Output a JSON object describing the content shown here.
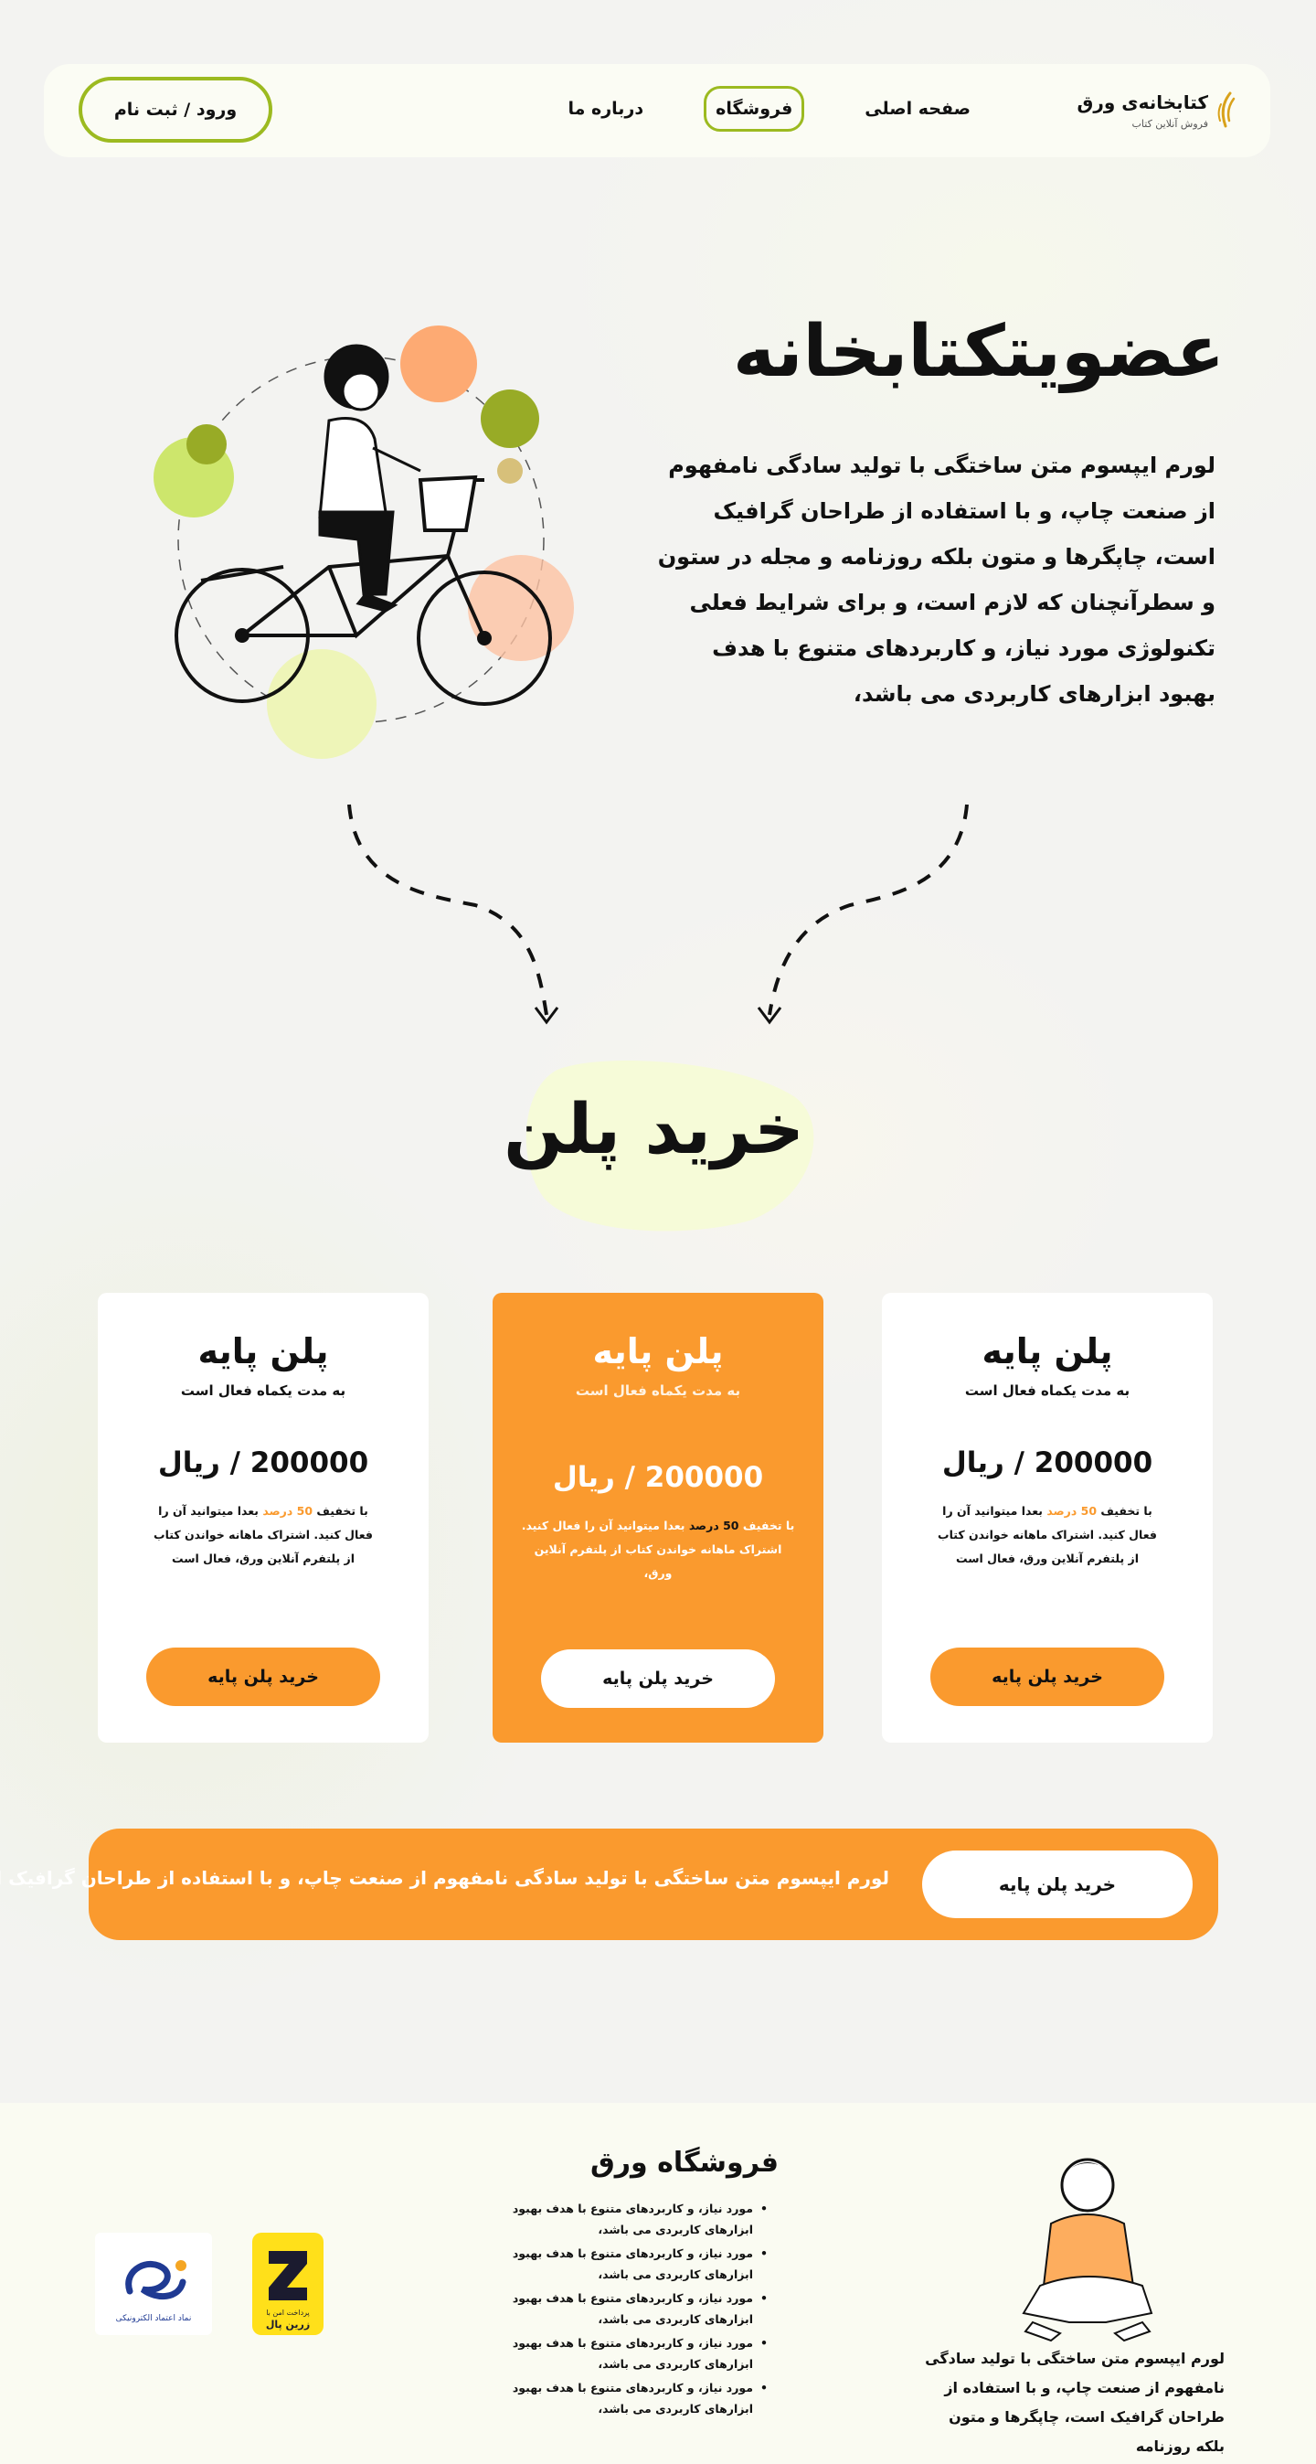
{
  "header": {
    "logo_name": "کتابخانه‌ی ورق",
    "logo_tagline": "فروش آنلاین کتاب",
    "nav": [
      {
        "label": "صفحه اصلی"
      },
      {
        "label": "فروشگاه"
      },
      {
        "label": "درباره ما"
      }
    ],
    "active_nav": "فروشگاه",
    "login_label": "ورود / ثبت نام",
    "accent_color": "#9cba20"
  },
  "hero": {
    "title": "عضویتکتابخانه",
    "text": "لورم ایپسوم متن ساختگی با تولید سادگی نامفهوم از صنعت چاپ، و با استفاده از طراحان گرافیک است، چاپگرها و متون بلکه روزنامه و مجله در ستون و سطرآنچنان که لازم است، و برای شرایط فعلی تکنولوژی مورد نیاز، و کاربردهای متنوع با هدف بهبود ابزارهای کاربردی می باشد،"
  },
  "plans": {
    "title": "خرید پلن",
    "cards": [
      {
        "title": "پلن پایه",
        "subtitle": "به مدت یکماه فعال است",
        "price": "200000 / ریال",
        "desc_prefix": "با تخفیف",
        "desc_highlight": "50 درصد",
        "desc_suffix": "بعدا میتوانید آن را فعال کنید. اشتراک ماهانه خواندن کتاب از پلتفرم آنلاین ورق، فعال است",
        "button": "خرید پلن پایه"
      },
      {
        "title": "پلن پایه",
        "subtitle": "به مدت یکماه فعال است",
        "price": "200000 / ریال",
        "desc_prefix": "با تخفیف",
        "desc_highlight": "50 درصد",
        "desc_suffix": "بعدا میتوانید آن را فعال کنید. اشتراک ماهانه خواندن کتاب از پلتفرم آنلاین ورق،",
        "button": "خرید پلن پایه"
      },
      {
        "title": "پلن پایه",
        "subtitle": "به مدت یکماه فعال است",
        "price": "200000 / ریال",
        "desc_prefix": "با تخفیف",
        "desc_highlight": "50 درصد",
        "desc_suffix": "بعدا میتوانید آن را فعال کنید. اشتراک ماهانه خواندن کتاب از پلتفرم آنلاین ورق، فعال است",
        "button": "خرید پلن پایه"
      }
    ],
    "accent_color": "#fa9a2e"
  },
  "banner": {
    "text": "لورم ایپسوم متن ساختگی با تولید سادگی نامفهوم از صنعت چاپ، و با استفاده از طراحان گرافیک است.",
    "button": "خرید پلن پایه"
  },
  "footer": {
    "about": "لورم ایپسوم متن ساختگی با تولید سادگی نامفهوم از صنعت چاپ، و با استفاده از طراحان گرافیک است، چاپگرها و متون بلکه روزنامه",
    "brand": "فروشگاه ورق",
    "items": [
      "مورد نیاز، و کاربردهای متنوع با هدف بهبود ابزارهای کاربردی می باشد،",
      "مورد نیاز، و کاربردهای متنوع با هدف بهبود ابزارهای کاربردی می باشد،",
      "مورد نیاز، و کاربردهای متنوع با هدف بهبود ابزارهای کاربردی می باشد،",
      "مورد نیاز، و کاربردهای متنوع با هدف بهبود ابزارهای کاربردی می باشد،",
      "مورد نیاز، و کاربردهای متنوع با هدف بهبود ابزارهای کاربردی می باشد،"
    ],
    "zarinpal_label": "پرداخت امن با",
    "zarinpal_name": "زرین پال",
    "enamad_label": "نماد اعتماد الکترونیکی"
  }
}
